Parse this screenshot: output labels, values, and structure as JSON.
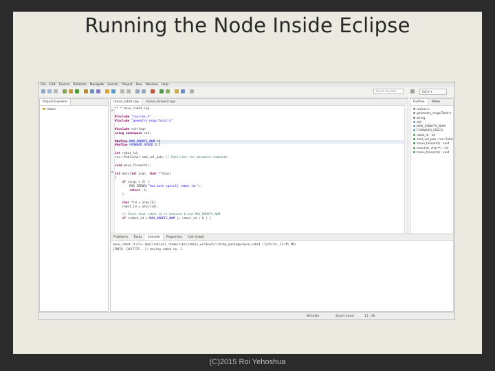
{
  "slide": {
    "title": "Running the Node Inside Eclipse",
    "footer": "(C)2015 Roi Yehoshua"
  },
  "ide": {
    "menu": [
      "File",
      "Edit",
      "Source",
      "Refactor",
      "Navigate",
      "Search",
      "Project",
      "Run",
      "Window",
      "Help"
    ],
    "quick_access_placeholder": "Quick Access",
    "perspective_label": "C/C++",
    "project_explorer": {
      "tab_label": "Project Explorer",
      "item": "move"
    },
    "editor_tabs": [
      "move_robot.cpp",
      "move_forward.cpp"
    ],
    "code_lines": [
      "/* * move_robot.cpp",
      "",
      "#include \"ros/ros.h\"",
      "#include \"geometry_msgs/Twist.h\"",
      "",
      "#include <string>",
      "using namespace std;",
      "",
      "#define MAX_ROBOTS_NUM 20",
      "#define FORWARD_SPEED 0.5",
      "",
      "int robot_id;",
      "ros::Publisher cmd_vel_pub; // Publisher for movement commands",
      "",
      "void move_forward();",
      "",
      "int main(int argc, char **argv)",
      "{",
      "    if (argc < 2) {",
      "        ROS_ERROR(\"You must specify robot id.\");",
      "        return -1;",
      "    }",
      "",
      "    char *id = argv[1];",
      "    robot_id = atoi(id);",
      "",
      "    // Check that robot id is between 0 and MAX_ROBOTS_NUM",
      "    if (robot_id > MAX_ROBOTS_NUM || robot_id < 0 ) {"
    ],
    "outline": {
      "tabs": [
        "Outline",
        "Make"
      ],
      "items": [
        "ros/ros.h",
        "geometry_msgs/Twist.h",
        "string",
        "std",
        "MAX_ROBOTS_NUM",
        "FORWARD_SPEED",
        "robot_id : int",
        "cmd_vel_pub : ros::Publisher",
        "move_forward() : void",
        "main(int, char**) : int",
        "move_forward() : void"
      ]
    },
    "bottom_tabs": [
      "Problems",
      "Tasks",
      "Console",
      "Properties",
      "Call Graph"
    ],
    "console_lines": [
      "move_robot [C/C++ Application] /home/viki/catkin_ws/devel/lib/my_package/move_robot (12/5/14, 12:45 PM)",
      "[INFO] [1417775...]: moving robot no. 1"
    ],
    "status": {
      "writable": "Writable",
      "insert_mode": "Smart Insert",
      "position": "11 : 26"
    },
    "colors": {
      "keyword": "#7f0055",
      "string": "#2a00ff",
      "comment": "#3f7f5f",
      "macro": "#0000c0"
    }
  }
}
